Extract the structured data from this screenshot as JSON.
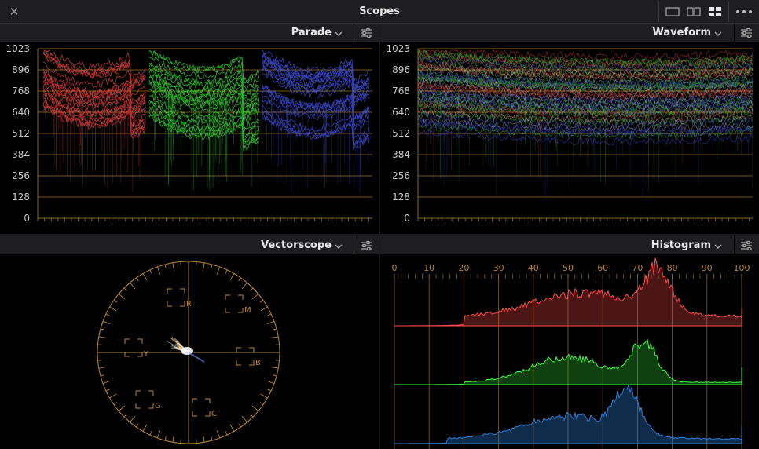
{
  "topbar": {
    "title": "Scopes",
    "close_icon": "close-icon",
    "layout_buttons": [
      "single-layout-icon",
      "dual-layout-icon",
      "quad-layout-icon"
    ],
    "active_layout": "quad",
    "more_icon": "more-options-icon"
  },
  "panels": {
    "parade": {
      "title": "Parade"
    },
    "waveform": {
      "title": "Waveform"
    },
    "vectorscope": {
      "title": "Vectorscope"
    },
    "histogram": {
      "title": "Histogram"
    }
  },
  "scale": {
    "ticks": [
      "1023",
      "896",
      "768",
      "640",
      "512",
      "384",
      "256",
      "128",
      "0"
    ]
  },
  "vectorscope": {
    "targets": [
      "R",
      "M",
      "B",
      "C",
      "G",
      "Y"
    ]
  },
  "histogram": {
    "ticks": [
      "0",
      "10",
      "20",
      "30",
      "40",
      "50",
      "60",
      "70",
      "80",
      "90",
      "100"
    ]
  },
  "colors": {
    "grid": "#b8862f",
    "red": "#ff4a4a",
    "green": "#3cff3c",
    "blue": "#4a5cff",
    "hist_blue": "#2f7fd8"
  }
}
